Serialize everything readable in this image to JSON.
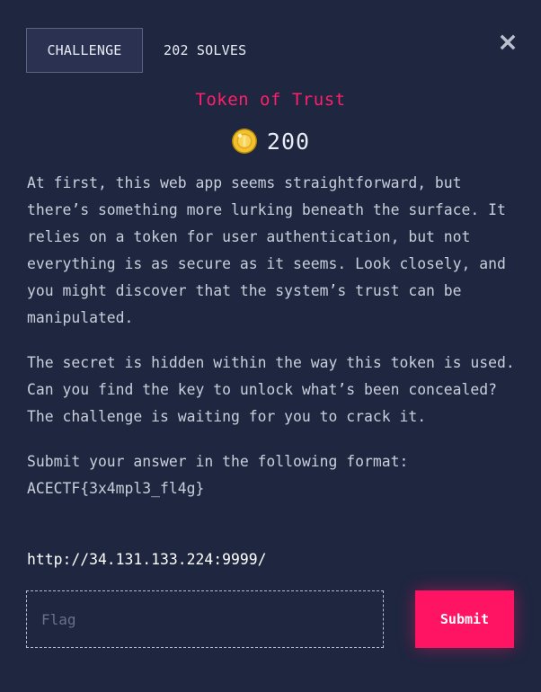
{
  "header": {
    "challenge_tab": "CHALLENGE",
    "solves_tab": "202 SOLVES"
  },
  "challenge": {
    "title": "Token of Trust",
    "points": "200",
    "description": [
      "At first, this web app seems straightforward, but there’s something more lurking beneath the surface. It relies on a token for user authentication, but not everything is as secure as it seems. Look closely, and you might discover that the system’s trust can be manipulated.",
      "The secret is hidden within the way this token is used. Can you find the key to unlock what’s been concealed? The challenge is waiting for you to crack it.",
      "Submit your answer in the following format: ACECTF{3x4mpl3_fl4g}"
    ],
    "link": "http://34.131.133.224:9999/"
  },
  "form": {
    "flag_placeholder": "Flag",
    "flag_value": "",
    "submit_label": "Submit"
  },
  "icons": {
    "close": "close-icon",
    "coin": "coin-icon"
  },
  "colors": {
    "background": "#1e2640",
    "accent": "#ff1463",
    "title": "#ff1f6b",
    "text": "#c9cfdb"
  }
}
